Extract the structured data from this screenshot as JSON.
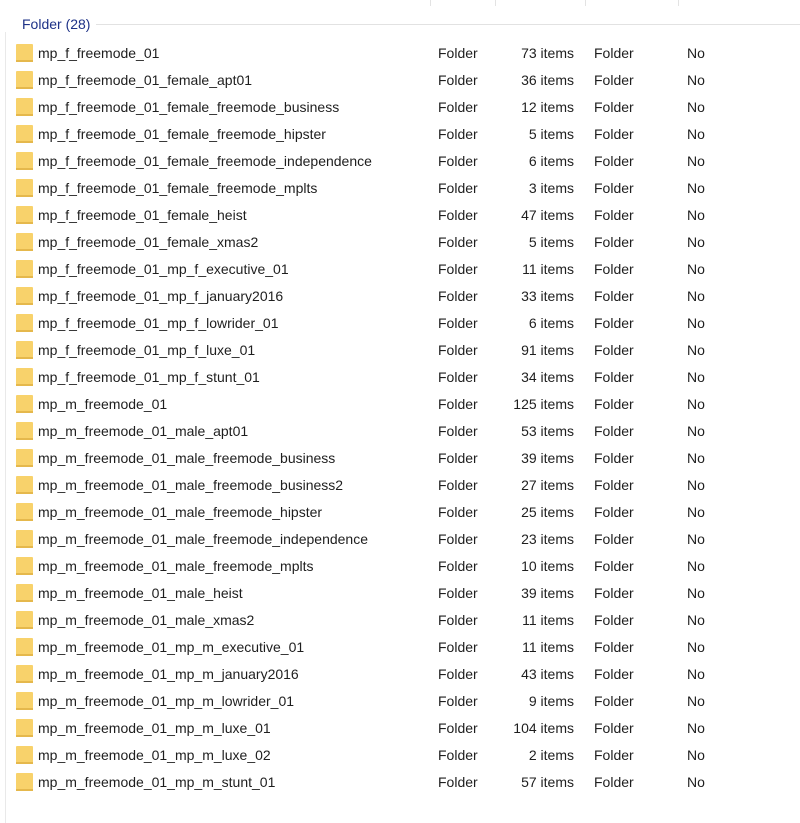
{
  "group": {
    "title": "Folder (28)"
  },
  "icons": {
    "row_icon": "folder-icon",
    "folder_color": "#f8d26b"
  },
  "rows": [
    {
      "name": "mp_f_freemode_01",
      "type": "Folder",
      "size": "73 items",
      "kind": "Folder",
      "flag": "No"
    },
    {
      "name": "mp_f_freemode_01_female_apt01",
      "type": "Folder",
      "size": "36 items",
      "kind": "Folder",
      "flag": "No"
    },
    {
      "name": "mp_f_freemode_01_female_freemode_business",
      "type": "Folder",
      "size": "12 items",
      "kind": "Folder",
      "flag": "No"
    },
    {
      "name": "mp_f_freemode_01_female_freemode_hipster",
      "type": "Folder",
      "size": "5 items",
      "kind": "Folder",
      "flag": "No"
    },
    {
      "name": "mp_f_freemode_01_female_freemode_independence",
      "type": "Folder",
      "size": "6 items",
      "kind": "Folder",
      "flag": "No"
    },
    {
      "name": "mp_f_freemode_01_female_freemode_mplts",
      "type": "Folder",
      "size": "3 items",
      "kind": "Folder",
      "flag": "No"
    },
    {
      "name": "mp_f_freemode_01_female_heist",
      "type": "Folder",
      "size": "47 items",
      "kind": "Folder",
      "flag": "No"
    },
    {
      "name": "mp_f_freemode_01_female_xmas2",
      "type": "Folder",
      "size": "5 items",
      "kind": "Folder",
      "flag": "No"
    },
    {
      "name": "mp_f_freemode_01_mp_f_executive_01",
      "type": "Folder",
      "size": "11 items",
      "kind": "Folder",
      "flag": "No"
    },
    {
      "name": "mp_f_freemode_01_mp_f_january2016",
      "type": "Folder",
      "size": "33 items",
      "kind": "Folder",
      "flag": "No"
    },
    {
      "name": "mp_f_freemode_01_mp_f_lowrider_01",
      "type": "Folder",
      "size": "6 items",
      "kind": "Folder",
      "flag": "No"
    },
    {
      "name": "mp_f_freemode_01_mp_f_luxe_01",
      "type": "Folder",
      "size": "91 items",
      "kind": "Folder",
      "flag": "No"
    },
    {
      "name": "mp_f_freemode_01_mp_f_stunt_01",
      "type": "Folder",
      "size": "34 items",
      "kind": "Folder",
      "flag": "No"
    },
    {
      "name": "mp_m_freemode_01",
      "type": "Folder",
      "size": "125 items",
      "kind": "Folder",
      "flag": "No"
    },
    {
      "name": "mp_m_freemode_01_male_apt01",
      "type": "Folder",
      "size": "53 items",
      "kind": "Folder",
      "flag": "No"
    },
    {
      "name": "mp_m_freemode_01_male_freemode_business",
      "type": "Folder",
      "size": "39 items",
      "kind": "Folder",
      "flag": "No"
    },
    {
      "name": "mp_m_freemode_01_male_freemode_business2",
      "type": "Folder",
      "size": "27 items",
      "kind": "Folder",
      "flag": "No"
    },
    {
      "name": "mp_m_freemode_01_male_freemode_hipster",
      "type": "Folder",
      "size": "25 items",
      "kind": "Folder",
      "flag": "No"
    },
    {
      "name": "mp_m_freemode_01_male_freemode_independence",
      "type": "Folder",
      "size": "23 items",
      "kind": "Folder",
      "flag": "No"
    },
    {
      "name": "mp_m_freemode_01_male_freemode_mplts",
      "type": "Folder",
      "size": "10 items",
      "kind": "Folder",
      "flag": "No"
    },
    {
      "name": "mp_m_freemode_01_male_heist",
      "type": "Folder",
      "size": "39 items",
      "kind": "Folder",
      "flag": "No"
    },
    {
      "name": "mp_m_freemode_01_male_xmas2",
      "type": "Folder",
      "size": "11 items",
      "kind": "Folder",
      "flag": "No"
    },
    {
      "name": "mp_m_freemode_01_mp_m_executive_01",
      "type": "Folder",
      "size": "11 items",
      "kind": "Folder",
      "flag": "No"
    },
    {
      "name": "mp_m_freemode_01_mp_m_january2016",
      "type": "Folder",
      "size": "43 items",
      "kind": "Folder",
      "flag": "No"
    },
    {
      "name": "mp_m_freemode_01_mp_m_lowrider_01",
      "type": "Folder",
      "size": "9 items",
      "kind": "Folder",
      "flag": "No"
    },
    {
      "name": "mp_m_freemode_01_mp_m_luxe_01",
      "type": "Folder",
      "size": "104 items",
      "kind": "Folder",
      "flag": "No"
    },
    {
      "name": "mp_m_freemode_01_mp_m_luxe_02",
      "type": "Folder",
      "size": "2 items",
      "kind": "Folder",
      "flag": "No"
    },
    {
      "name": "mp_m_freemode_01_mp_m_stunt_01",
      "type": "Folder",
      "size": "57 items",
      "kind": "Folder",
      "flag": "No"
    }
  ]
}
